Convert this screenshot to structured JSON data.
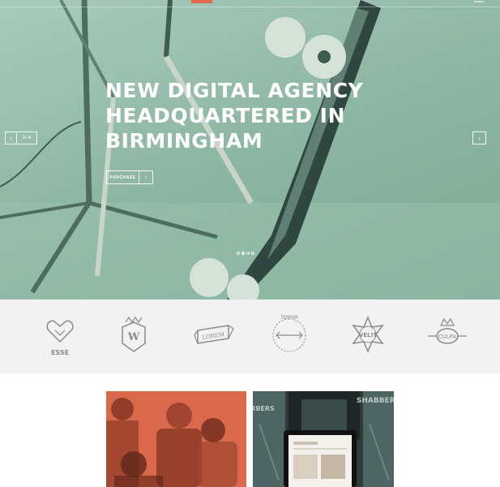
{
  "hero": {
    "title_lines": [
      "NEW DIGITAL AGENCY",
      "HEADQUARTERED IN",
      "BIRMINGHAM"
    ],
    "cta_label": "PURCHASE",
    "cta_arrow": "›",
    "slide_counter": "2 / 4",
    "prev_arrow": "‹",
    "next_arrow": "›",
    "slide_count": 4,
    "active_slide": 2,
    "overlay_color": "#8fb8a5"
  },
  "logos": [
    {
      "name": "esse",
      "text": "ESSE"
    },
    {
      "name": "w",
      "text": "W"
    },
    {
      "name": "lorem",
      "text": "LOREM"
    },
    {
      "name": "tempor",
      "text": "TEMPOR"
    },
    {
      "name": "velit",
      "text": "VELIT"
    },
    {
      "name": "culpa",
      "text": "CULPA"
    }
  ],
  "cards": {
    "shop_sign": "SHABBERS",
    "shop_sign_left": "RBERS"
  },
  "colors": {
    "accent": "#e5674a",
    "hero_mint": "#8fb8a5",
    "strip_bg": "#f2f2f2",
    "logo_stroke": "#8a8a8a"
  }
}
